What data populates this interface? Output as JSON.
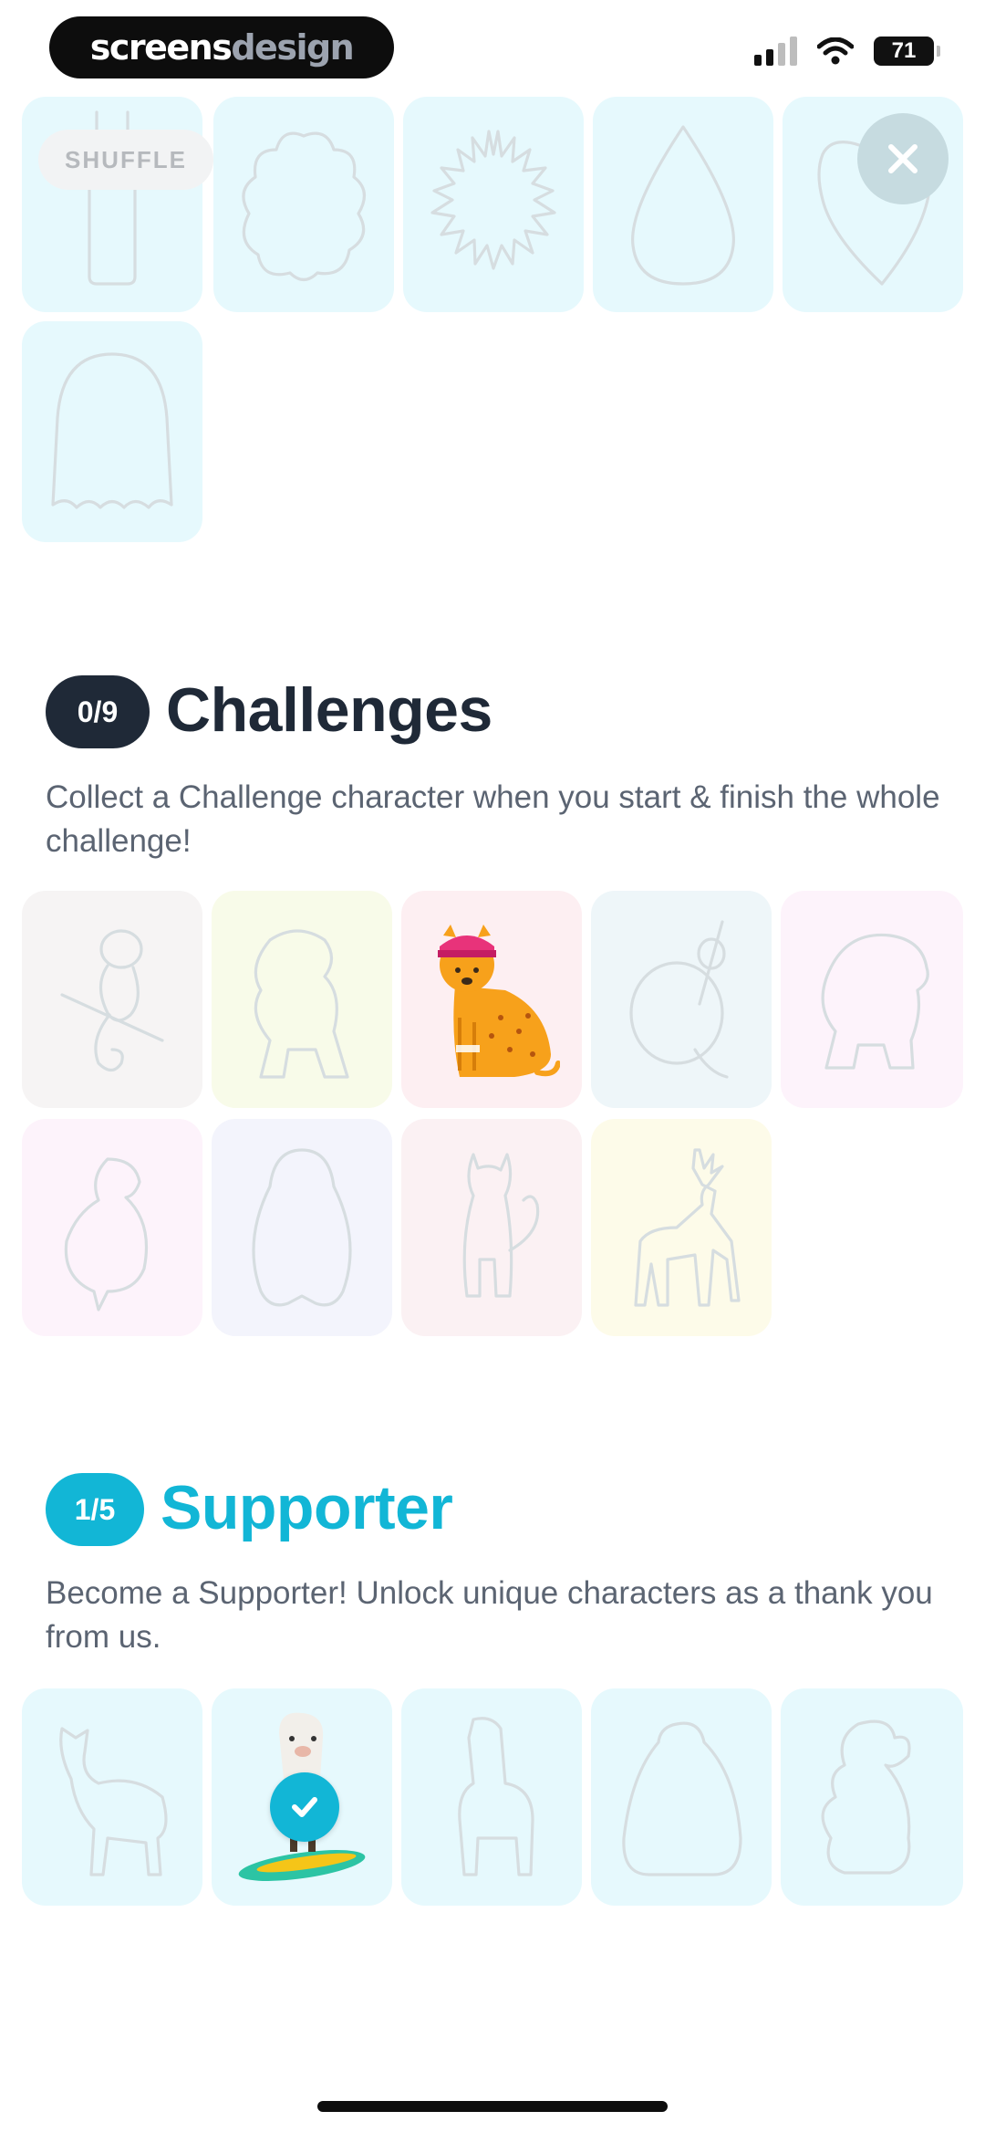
{
  "status_bar": {
    "brand_bold": "screens",
    "brand_light": "design",
    "battery_level": "71"
  },
  "shapes_section": {
    "shuffle_label": "SHUFFLE",
    "tile_color": "#e6f9fd"
  },
  "challenges": {
    "counter": "0/9",
    "title": "Challenges",
    "description": "Collect a Challenge character when you start & finish the whole challenge!",
    "accent": "#1f2937",
    "tiles": [
      {
        "name": "monkey",
        "bg": "#f6f4f4",
        "unlocked": false
      },
      {
        "name": "dinosaur",
        "bg": "#f8fbe9",
        "unlocked": false
      },
      {
        "name": "cheetah",
        "bg": "#fdeff2",
        "unlocked": true
      },
      {
        "name": "sloth",
        "bg": "#eef6f9",
        "unlocked": false
      },
      {
        "name": "bear",
        "bg": "#fdf3fb",
        "unlocked": false
      },
      {
        "name": "bird",
        "bg": "#fdf3fb",
        "unlocked": false
      },
      {
        "name": "penguin",
        "bg": "#f3f4fc",
        "unlocked": false
      },
      {
        "name": "cat",
        "bg": "#fbf1f3",
        "unlocked": false
      },
      {
        "name": "deer",
        "bg": "#fdfbe9",
        "unlocked": false
      }
    ]
  },
  "supporter": {
    "counter": "1/5",
    "title": "Supporter",
    "description": "Become a Supporter! Unlock unique characters as a thank you from us.",
    "accent": "#12b6d6",
    "tiles": [
      {
        "name": "okapi",
        "unlocked": false
      },
      {
        "name": "llama-surfer",
        "unlocked": true
      },
      {
        "name": "llama",
        "unlocked": false
      },
      {
        "name": "blob",
        "unlocked": false
      },
      {
        "name": "poodle",
        "unlocked": false
      }
    ]
  }
}
